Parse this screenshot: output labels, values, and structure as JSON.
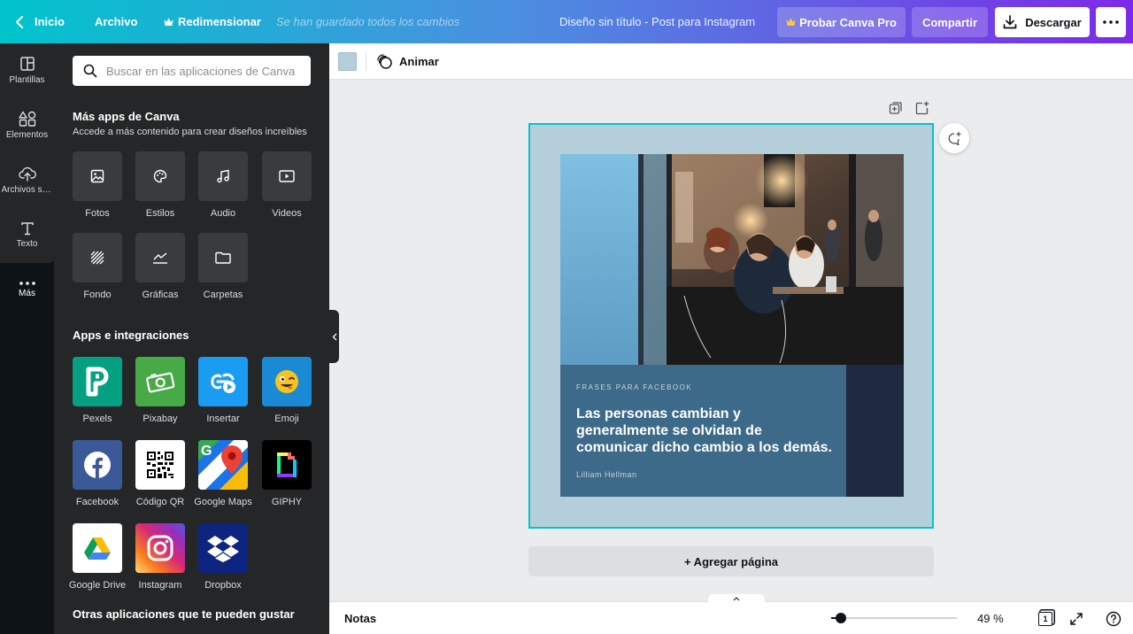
{
  "topbar": {
    "home_label": "Inicio",
    "file_label": "Archivo",
    "resize_label": "Redimensionar",
    "saved_status": "Se han guardado todos los cambios",
    "design_title": "Diseño sin título - Post para Instagram",
    "try_pro_label": "Probar Canva Pro",
    "share_label": "Compartir",
    "download_label": "Descargar",
    "more_label": "•••"
  },
  "rail": {
    "items": [
      {
        "label": "Plantillas",
        "icon": "template-icon"
      },
      {
        "label": "Elementos",
        "icon": "elements-icon"
      },
      {
        "label": "Archivos subidos",
        "icon": "upload-icon"
      },
      {
        "label": "Texto",
        "icon": "text-icon"
      },
      {
        "label": "Más",
        "icon": "more-icon"
      }
    ]
  },
  "panel": {
    "search_placeholder": "Buscar en las aplicaciones de Canva",
    "more_apps_title": "Más apps de Canva",
    "more_apps_subtitle": "Accede a más contenido para crear diseños increíbles",
    "tiles": [
      {
        "label": "Fotos",
        "icon": "photo-icon"
      },
      {
        "label": "Estilos",
        "icon": "palette-icon"
      },
      {
        "label": "Audio",
        "icon": "music-icon"
      },
      {
        "label": "Videos",
        "icon": "video-icon"
      },
      {
        "label": "Fondo",
        "icon": "background-icon"
      },
      {
        "label": "Gráficas",
        "icon": "chart-icon"
      },
      {
        "label": "Carpetas",
        "icon": "folder-icon"
      }
    ],
    "integrations_title": "Apps e integraciones",
    "apps": [
      {
        "label": "Pexels",
        "icon": "pexels-icon",
        "color": "#05a081"
      },
      {
        "label": "Pixabay",
        "icon": "pixabay-icon",
        "color": "#48a947"
      },
      {
        "label": "Insertar",
        "icon": "embed-icon",
        "color": "#1a9cf3"
      },
      {
        "label": "Emoji",
        "icon": "emoji-icon",
        "color": "#1a8ad4"
      },
      {
        "label": "Facebook",
        "icon": "facebook-icon",
        "color": "#3b5998"
      },
      {
        "label": "Código QR",
        "icon": "qr-code-icon",
        "color": "#ffffff"
      },
      {
        "label": "Google Maps",
        "icon": "google-maps-icon",
        "color": "#ffffff"
      },
      {
        "label": "GIPHY",
        "icon": "giphy-icon",
        "color": "#000000"
      },
      {
        "label": "Google Drive",
        "icon": "google-drive-icon",
        "color": "#ffffff"
      },
      {
        "label": "Instagram",
        "icon": "instagram-icon",
        "color": "#e1306c"
      },
      {
        "label": "Dropbox",
        "icon": "dropbox-icon",
        "color": "#0d2481"
      }
    ],
    "other_apps_title": "Otras aplicaciones que te pueden gustar"
  },
  "toolbar": {
    "background_color": "#b5cfda",
    "animate_label": "Animar"
  },
  "design": {
    "kicker": "FRASES PARA FACEBOOK",
    "quote": "Las personas cambian y generalmente se olvidan de comunicar dicho cambio a los demás.",
    "author": "Lilliam Hellman",
    "card_color": "#3e6a8a",
    "accent_color": "#1e2a3f"
  },
  "canvas": {
    "add_page_label": "+ Agregar página"
  },
  "bottombar": {
    "notes_label": "Notas",
    "zoom_label": "49 %",
    "zoom_fraction": 0.08,
    "page_count": "1"
  }
}
